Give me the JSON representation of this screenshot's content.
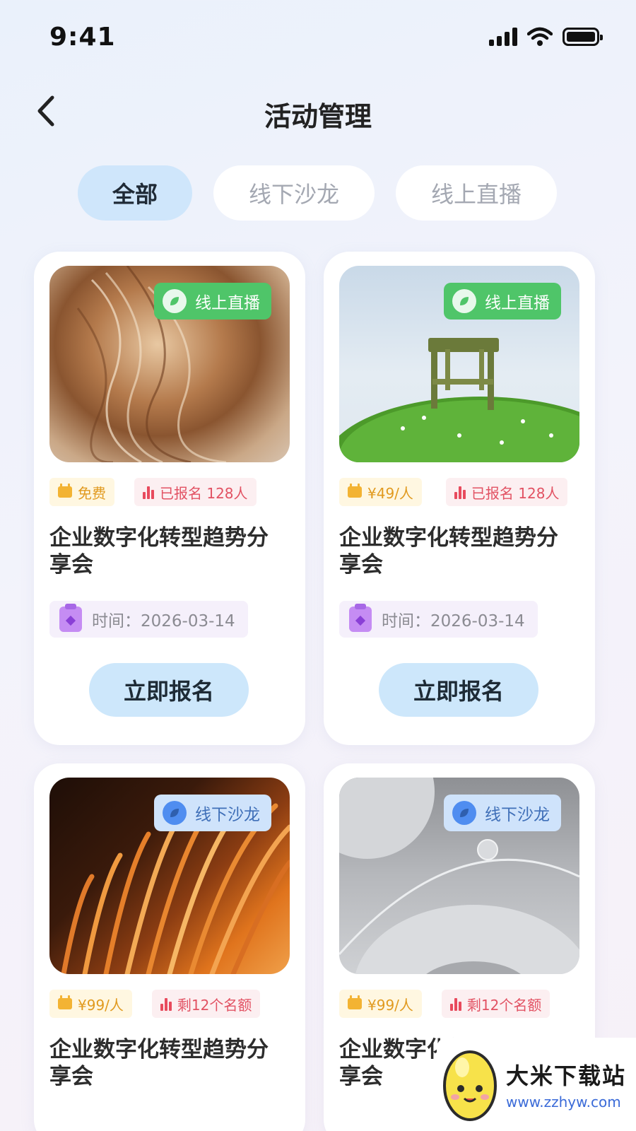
{
  "status_bar": {
    "time": "9:41"
  },
  "header": {
    "title": "活动管理"
  },
  "tabs": [
    {
      "label": "全部",
      "active": true
    },
    {
      "label": "线下沙龙",
      "active": false
    },
    {
      "label": "线上直播",
      "active": false
    }
  ],
  "cards": [
    {
      "badge": "线上直播",
      "price": "免费",
      "status": "已报名 128人",
      "title": "企业数字化转型趋势分享会",
      "time": "时间：2026-03-14",
      "button": "立即报名"
    },
    {
      "badge": "线上直播",
      "price": "¥49/人",
      "status": "已报名 128人",
      "title": "企业数字化转型趋势分享会",
      "time": "时间：2026-03-14",
      "button": "立即报名"
    },
    {
      "badge": "线下沙龙",
      "price": "¥99/人",
      "status": "剩12个名额",
      "title": "企业数字化转型趋势分享会"
    },
    {
      "badge": "线下沙龙",
      "price": "¥99/人",
      "status": "剩12个名额",
      "title": "企业数字化转型趋势分享会"
    }
  ],
  "watermark": {
    "name": "大米下载站",
    "url": "www.zzhyw.com"
  },
  "colors": {
    "accent": "#cfe6fb",
    "online_badge": "#4fc569",
    "offline_badge": "#cfe3fb",
    "price": "#e19a1f",
    "registered": "#e25263"
  }
}
